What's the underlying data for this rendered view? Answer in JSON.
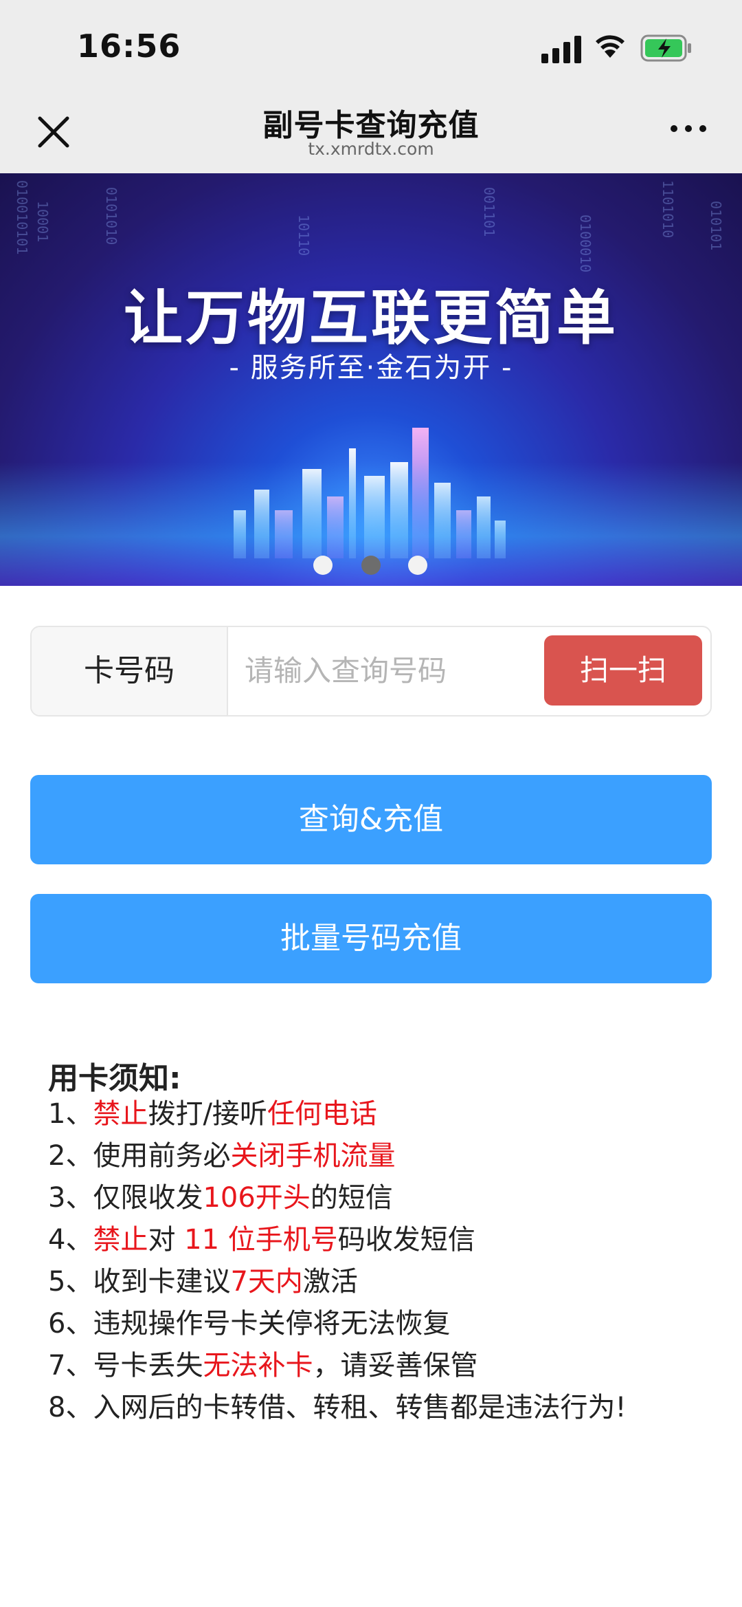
{
  "status_bar": {
    "time": "16:56"
  },
  "header": {
    "title": "副号卡查询充值",
    "url": "tx.xmrdtx.com"
  },
  "banner": {
    "headline": "让万物互联更简单",
    "subline": "- 服务所至·金石为开 -",
    "active_slide": 2,
    "slide_count": 3
  },
  "query": {
    "label": "卡号码",
    "placeholder": "请输入查询号码",
    "scan_label": "扫一扫"
  },
  "buttons": {
    "query_recharge": "查询&充值",
    "batch_recharge": "批量号码充值"
  },
  "notice": {
    "title": "用卡须知:",
    "items": [
      [
        {
          "t": "1、"
        },
        {
          "t": "禁止",
          "red": true
        },
        {
          "t": "拨打/接听"
        },
        {
          "t": "任何电话",
          "red": true
        }
      ],
      [
        {
          "t": "2、使用前务必"
        },
        {
          "t": "关闭手机流量",
          "red": true
        }
      ],
      [
        {
          "t": "3、仅限收发"
        },
        {
          "t": "106开头",
          "red": true
        },
        {
          "t": "的短信"
        }
      ],
      [
        {
          "t": "4、"
        },
        {
          "t": "禁止",
          "red": true
        },
        {
          "t": "对 "
        },
        {
          "t": "11 位手机号",
          "red": true
        },
        {
          "t": "码收发短信"
        }
      ],
      [
        {
          "t": "5、收到卡建议"
        },
        {
          "t": "7天内",
          "red": true
        },
        {
          "t": "激活"
        }
      ],
      [
        {
          "t": "6、违规操作号卡关停将无法恢复"
        }
      ],
      [
        {
          "t": "7、号卡丢失"
        },
        {
          "t": "无法补卡",
          "red": true
        },
        {
          "t": "，请妥善保管"
        }
      ],
      [
        {
          "t": "8、入网后的卡转借、转租、转售都是违法行为!"
        }
      ]
    ]
  },
  "colors": {
    "accent_blue": "#3ba0ff",
    "scan_red": "#d9544f",
    "highlight_red": "#e8161c",
    "header_bg": "#ededed"
  }
}
